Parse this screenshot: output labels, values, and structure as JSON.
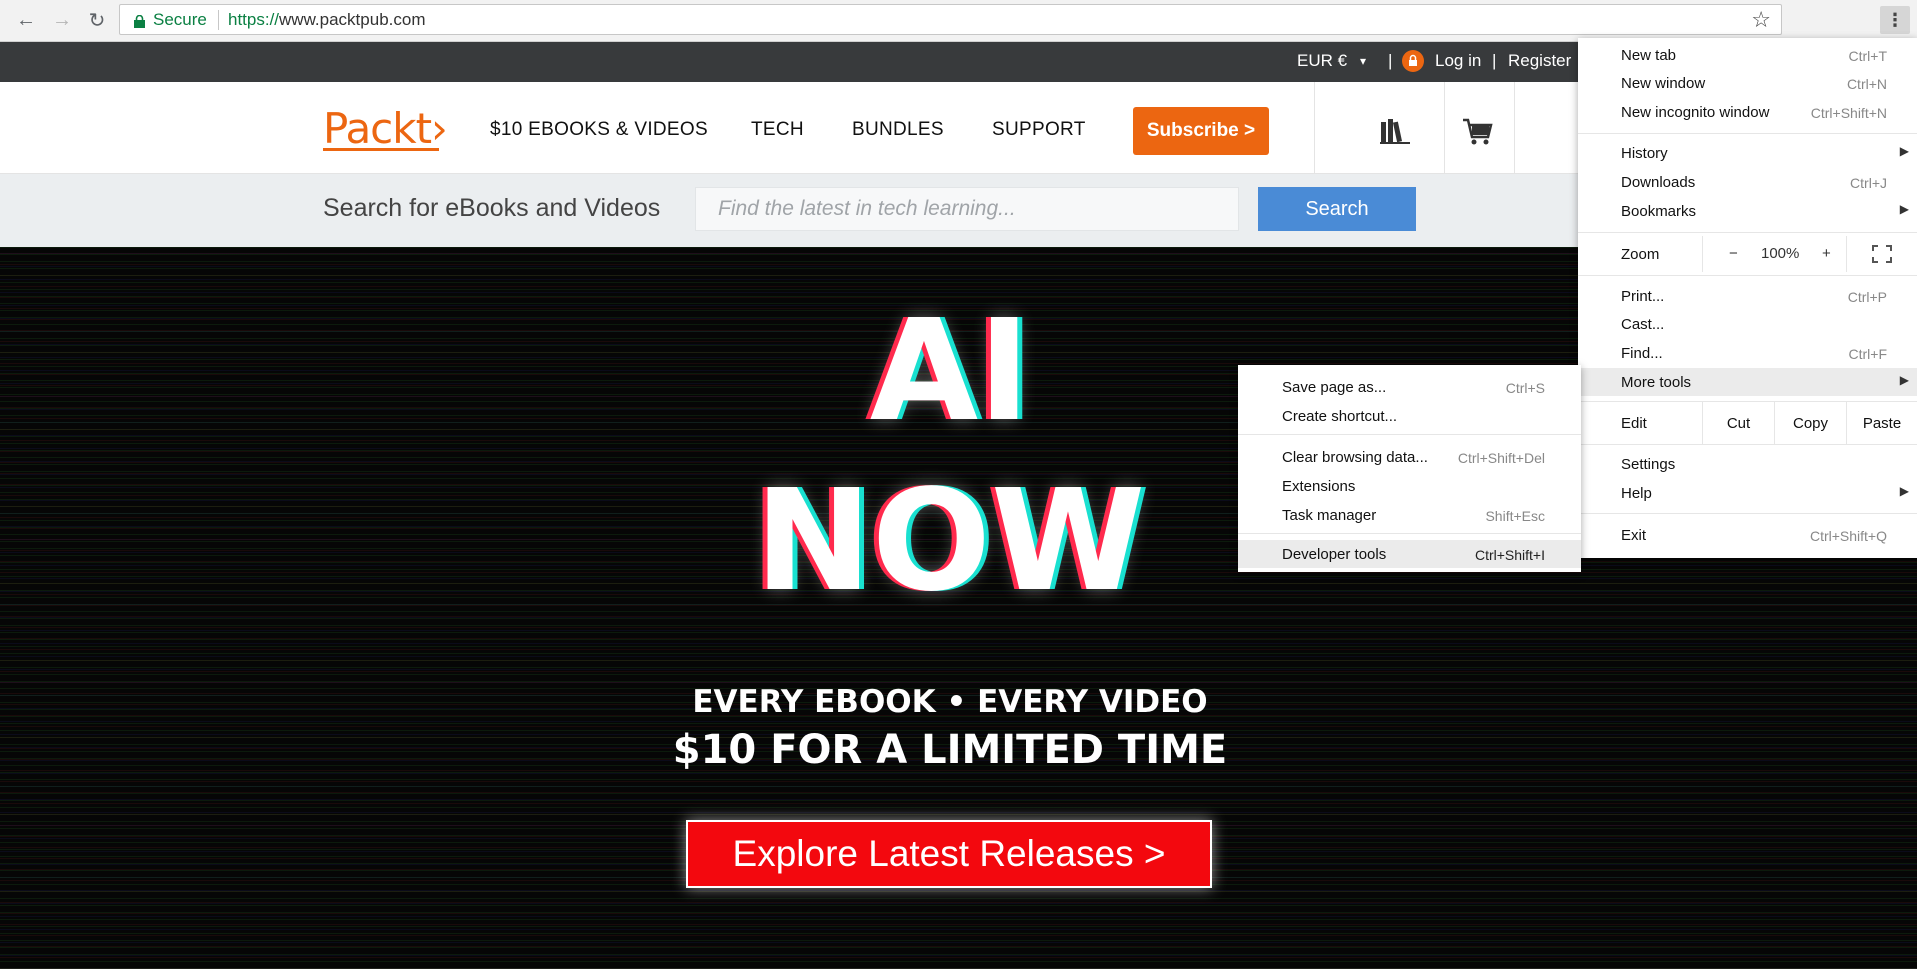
{
  "browser": {
    "secure_label": "Secure",
    "url_scheme": "https://",
    "url_host": "www.packtpub.com",
    "back_icon": "←",
    "forward_icon": "→",
    "reload_icon": "↻",
    "star_icon": "☆",
    "menu_icon": "⋮"
  },
  "topbar": {
    "currency": "EUR €",
    "currency_caret": "▾",
    "divider1": "|",
    "login": "Log in",
    "divider2": "|",
    "register": "Register"
  },
  "header": {
    "logo": "Packt›",
    "nav": [
      "$10 EBOOKS & VIDEOS",
      "TECH",
      "BUNDLES",
      "SUPPORT"
    ],
    "subscribe": "Subscribe >",
    "library_icon": "library-icon",
    "cart_icon": "cart-icon"
  },
  "search": {
    "title": "Search for eBooks and Videos",
    "placeholder": "Find the latest in tech learning...",
    "button": "Search"
  },
  "hero": {
    "line1": "AI",
    "line2": "NOW",
    "tagline1": "EVERY EBOOK  • EVERY VIDEO",
    "tagline2": "$10 FOR A LIMITED TIME",
    "cta": "Explore Latest Releases >"
  },
  "chrome_menu": {
    "new_tab": {
      "label": "New tab",
      "shortcut": "Ctrl+T"
    },
    "new_window": {
      "label": "New window",
      "shortcut": "Ctrl+N"
    },
    "new_incognito": {
      "label": "New incognito window",
      "shortcut": "Ctrl+Shift+N"
    },
    "history": {
      "label": "History"
    },
    "downloads": {
      "label": "Downloads",
      "shortcut": "Ctrl+J"
    },
    "bookmarks": {
      "label": "Bookmarks"
    },
    "zoom": {
      "label": "Zoom",
      "minus": "−",
      "value": "100%",
      "plus": "+"
    },
    "print": {
      "label": "Print...",
      "shortcut": "Ctrl+P"
    },
    "cast": {
      "label": "Cast..."
    },
    "find": {
      "label": "Find...",
      "shortcut": "Ctrl+F"
    },
    "more_tools": {
      "label": "More tools"
    },
    "edit": {
      "label": "Edit",
      "cut": "Cut",
      "copy": "Copy",
      "paste": "Paste"
    },
    "settings": {
      "label": "Settings"
    },
    "help": {
      "label": "Help"
    },
    "exit": {
      "label": "Exit",
      "shortcut": "Ctrl+Shift+Q"
    },
    "arrow": "▶"
  },
  "more_tools_menu": {
    "save_page": {
      "label": "Save page as...",
      "shortcut": "Ctrl+S"
    },
    "create_shortcut": {
      "label": "Create shortcut..."
    },
    "clear_data": {
      "label": "Clear browsing data...",
      "shortcut": "Ctrl+Shift+Del"
    },
    "extensions": {
      "label": "Extensions"
    },
    "task_manager": {
      "label": "Task manager",
      "shortcut": "Shift+Esc"
    },
    "developer_tools": {
      "label": "Developer tools",
      "shortcut": "Ctrl+Shift+I"
    }
  },
  "colors": {
    "brand": "#ec6611",
    "search_button": "#4a8bd6",
    "cta": "#f3080e",
    "secure": "#0b8043"
  }
}
